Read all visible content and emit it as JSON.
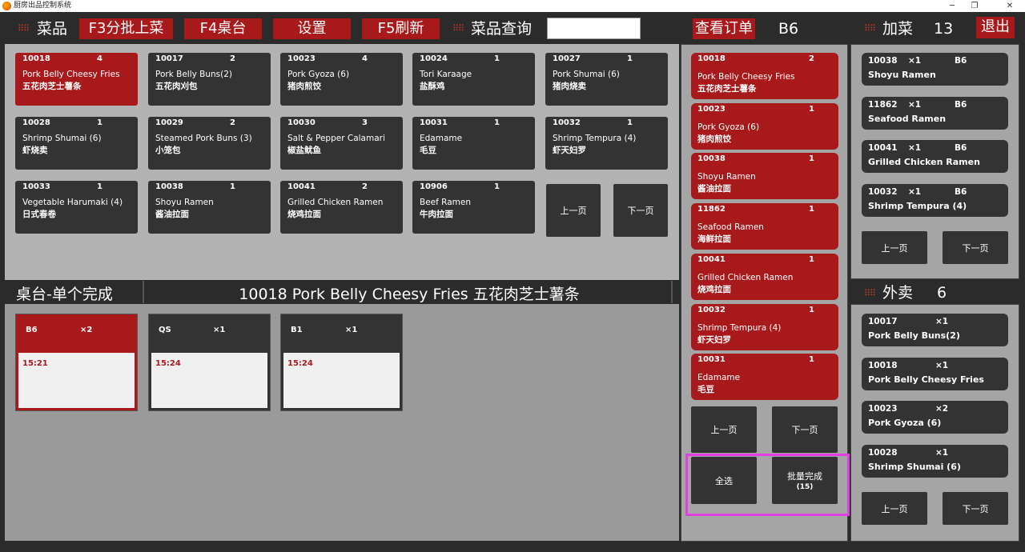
{
  "window": {
    "title": "厨房出品控制系统"
  },
  "topbar": {
    "dishes_label": "菜品",
    "batch_button": "F3分批上菜",
    "tables_button": "F4桌台",
    "settings_button": "设置",
    "refresh_button": "F5刷新",
    "query_label": "菜品查询",
    "search_value": "",
    "view_orders_button": "查看订单",
    "current_table": "B6",
    "add_dish_label": "加菜",
    "add_dish_count": "13",
    "exit_button": "退出"
  },
  "dishes": [
    {
      "id": "10018",
      "qty": "4",
      "en": "Pork Belly Cheesy Fries",
      "cn": "五花肉芝士薯条",
      "selected": true
    },
    {
      "id": "10017",
      "qty": "2",
      "en": "Pork Belly Buns(2)",
      "cn": "五花肉刈包",
      "selected": false
    },
    {
      "id": "10023",
      "qty": "4",
      "en": "Pork Gyoza (6)",
      "cn": "猪肉煎饺",
      "selected": false
    },
    {
      "id": "10024",
      "qty": "1",
      "en": "Tori Karaage",
      "cn": "盐酥鸡",
      "selected": false
    },
    {
      "id": "10027",
      "qty": "1",
      "en": "Pork Shumai (6)",
      "cn": "猪肉烧卖",
      "selected": false
    },
    {
      "id": "10028",
      "qty": "1",
      "en": "Shrimp Shumai (6)",
      "cn": "虾烧卖",
      "selected": false
    },
    {
      "id": "10029",
      "qty": "2",
      "en": "Steamed Pork Buns (3)",
      "cn": "小笼包",
      "selected": false
    },
    {
      "id": "10030",
      "qty": "3",
      "en": "Salt & Pepper Calamari",
      "cn": "椒盐鱿鱼",
      "selected": false
    },
    {
      "id": "10031",
      "qty": "1",
      "en": "Edamame",
      "cn": "毛豆",
      "selected": false
    },
    {
      "id": "10032",
      "qty": "1",
      "en": "Shrimp Tempura (4)",
      "cn": "虾天妇罗",
      "selected": false
    },
    {
      "id": "10033",
      "qty": "1",
      "en": "Vegetable Harumaki (4)",
      "cn": "日式春卷",
      "selected": false
    },
    {
      "id": "10038",
      "qty": "1",
      "en": "Shoyu Ramen",
      "cn": "酱油拉面",
      "selected": false
    },
    {
      "id": "10041",
      "qty": "2",
      "en": "Grilled Chicken Ramen",
      "cn": "烧鸡拉面",
      "selected": false
    },
    {
      "id": "10906",
      "qty": "1",
      "en": "Beef Ramen",
      "cn": "牛肉拉面",
      "selected": false
    }
  ],
  "dish_pager": {
    "prev": "上一页",
    "next": "下一页"
  },
  "table_section": {
    "label": "桌台-单个完成",
    "selected_dish": "10018  Pork Belly Cheesy Fries  五花肉芝士薯条",
    "tables": [
      {
        "name": "B6",
        "count": "×2",
        "time": "15:21",
        "selected": true
      },
      {
        "name": "QS",
        "count": "×1",
        "time": "15:24",
        "selected": false
      },
      {
        "name": "B1",
        "count": "×1",
        "time": "15:24",
        "selected": false
      }
    ]
  },
  "orders": {
    "items": [
      {
        "id": "10018",
        "qty": "2",
        "en": "Pork Belly Cheesy Fries",
        "cn": "五花肉芝士薯条"
      },
      {
        "id": "10023",
        "qty": "1",
        "en": "Pork Gyoza (6)",
        "cn": "猪肉煎饺"
      },
      {
        "id": "10038",
        "qty": "1",
        "en": "Shoyu Ramen",
        "cn": "酱油拉面"
      },
      {
        "id": "11862",
        "qty": "1",
        "en": "Seafood Ramen",
        "cn": "海鲜拉面"
      },
      {
        "id": "10041",
        "qty": "1",
        "en": "Grilled Chicken Ramen",
        "cn": "烧鸡拉面"
      },
      {
        "id": "10032",
        "qty": "1",
        "en": "Shrimp Tempura (4)",
        "cn": "虾天妇罗"
      },
      {
        "id": "10031",
        "qty": "1",
        "en": "Edamame",
        "cn": "毛豆"
      }
    ],
    "prev": "上一页",
    "next": "下一页",
    "select_all": "全选",
    "batch_complete": "批量完成",
    "batch_count": "(15)"
  },
  "add_dish": {
    "items": [
      {
        "id": "10038",
        "qty": "×1",
        "table": "B6",
        "name": "Shoyu Ramen"
      },
      {
        "id": "11862",
        "qty": "×1",
        "table": "B6",
        "name": "Seafood Ramen"
      },
      {
        "id": "10041",
        "qty": "×1",
        "table": "B6",
        "name": "Grilled Chicken Ramen"
      },
      {
        "id": "10032",
        "qty": "×1",
        "table": "B6",
        "name": "Shrimp Tempura (4)"
      }
    ],
    "prev": "上一页",
    "next": "下一页"
  },
  "takeout": {
    "label": "外卖",
    "count": "6",
    "items": [
      {
        "id": "10017",
        "qty": "×1",
        "name": "Pork Belly Buns(2)"
      },
      {
        "id": "10018",
        "qty": "×1",
        "name": "Pork Belly Cheesy Fries"
      },
      {
        "id": "10023",
        "qty": "×2",
        "name": "Pork Gyoza (6)"
      },
      {
        "id": "10028",
        "qty": "×1",
        "name": "Shrimp Shumai (6)"
      }
    ],
    "prev": "上一页",
    "next": "下一页"
  },
  "colors": {
    "accent_red": "#a8191c",
    "highlight_magenta": "#e040e0",
    "card_dark": "#333333"
  }
}
